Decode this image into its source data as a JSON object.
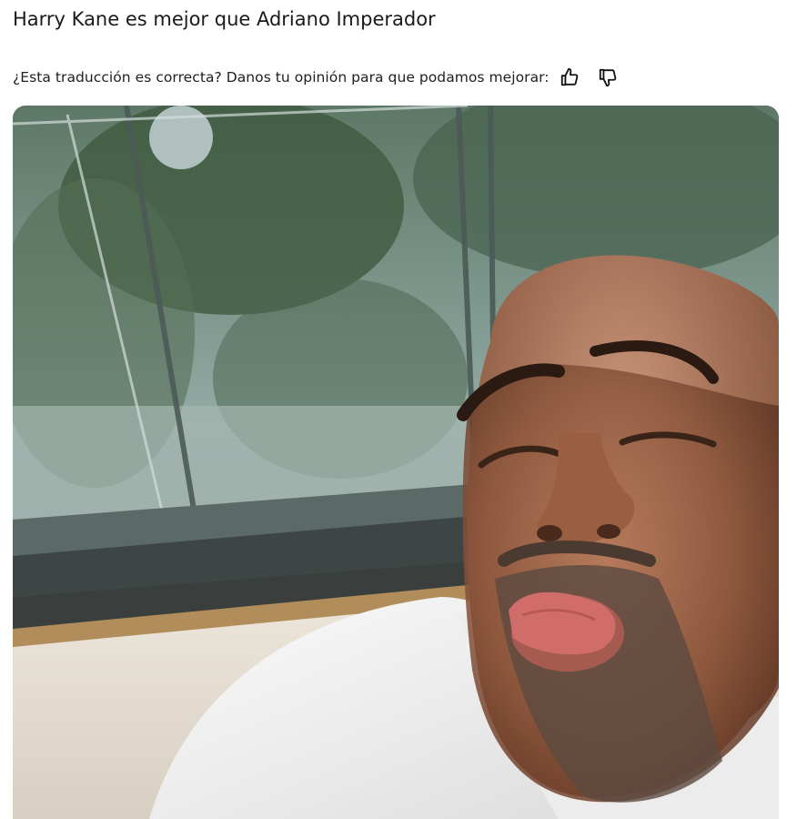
{
  "post": {
    "title": "Harry Kane es mejor que Adriano Imperador"
  },
  "translation_feedback": {
    "prompt": "¿Esta traducción es correcta? Danos tu opinión para que podamos mejorar:",
    "like_icon": "thumbs-up-icon",
    "dislike_icon": "thumbs-down-icon"
  },
  "media": {
    "type": "photo"
  },
  "colors": {
    "text": "#1a1a1a",
    "background": "#ffffff"
  }
}
